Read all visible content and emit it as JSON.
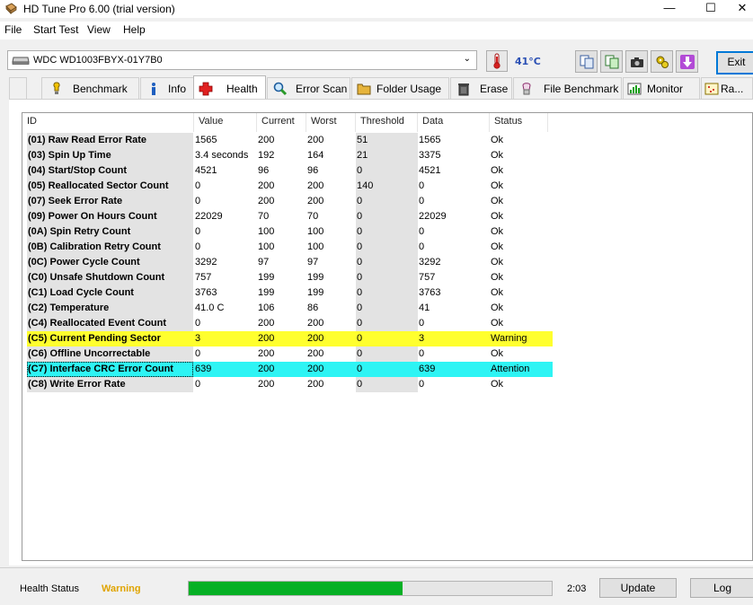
{
  "window": {
    "title": "HD Tune Pro 6.00 (trial version)",
    "minimize": "—",
    "maximize": "☐",
    "close": "✕"
  },
  "menu": {
    "file": "File",
    "start_test": "Start Test",
    "view": "View",
    "help": "Help"
  },
  "drive": {
    "selected": "WDC WD1003FBYX-01Y7B0"
  },
  "temperature": "41°C",
  "toolbar": {
    "exit_label": "Exit"
  },
  "tabs": [
    {
      "label": "Benchmark",
      "icon": "benchmark-icon"
    },
    {
      "label": "Info",
      "icon": "info-icon"
    },
    {
      "label": "Health",
      "icon": "health-cross-icon",
      "active": true
    },
    {
      "label": "Error Scan",
      "icon": "magnifier-icon"
    },
    {
      "label": "Folder Usage",
      "icon": "folder-icon"
    },
    {
      "label": "Erase",
      "icon": "trash-icon"
    },
    {
      "label": "File Benchmark",
      "icon": "file-benchmark-icon"
    },
    {
      "label": "Monitor",
      "icon": "monitor-icon"
    },
    {
      "label": "Ra...",
      "icon": "random-access-icon"
    }
  ],
  "table": {
    "columns": [
      "ID",
      "Value",
      "Current",
      "Worst",
      "Threshold",
      "Data",
      "Status"
    ],
    "rows": [
      {
        "id": "(01) Raw Read Error Rate",
        "value": "1565",
        "current": "200",
        "worst": "200",
        "threshold": "51",
        "data": "1565",
        "status": "Ok"
      },
      {
        "id": "(03) Spin Up Time",
        "value": "3.4 seconds",
        "current": "192",
        "worst": "164",
        "threshold": "21",
        "data": "3375",
        "status": "Ok"
      },
      {
        "id": "(04) Start/Stop Count",
        "value": "4521",
        "current": "96",
        "worst": "96",
        "threshold": "0",
        "data": "4521",
        "status": "Ok"
      },
      {
        "id": "(05) Reallocated Sector Count",
        "value": "0",
        "current": "200",
        "worst": "200",
        "threshold": "140",
        "data": "0",
        "status": "Ok"
      },
      {
        "id": "(07) Seek Error Rate",
        "value": "0",
        "current": "200",
        "worst": "200",
        "threshold": "0",
        "data": "0",
        "status": "Ok"
      },
      {
        "id": "(09) Power On Hours Count",
        "value": "22029",
        "current": "70",
        "worst": "70",
        "threshold": "0",
        "data": "22029",
        "status": "Ok"
      },
      {
        "id": "(0A) Spin Retry Count",
        "value": "0",
        "current": "100",
        "worst": "100",
        "threshold": "0",
        "data": "0",
        "status": "Ok"
      },
      {
        "id": "(0B) Calibration Retry Count",
        "value": "0",
        "current": "100",
        "worst": "100",
        "threshold": "0",
        "data": "0",
        "status": "Ok"
      },
      {
        "id": "(0C) Power Cycle Count",
        "value": "3292",
        "current": "97",
        "worst": "97",
        "threshold": "0",
        "data": "3292",
        "status": "Ok"
      },
      {
        "id": "(C0) Unsafe Shutdown Count",
        "value": "757",
        "current": "199",
        "worst": "199",
        "threshold": "0",
        "data": "757",
        "status": "Ok"
      },
      {
        "id": "(C1) Load Cycle Count",
        "value": "3763",
        "current": "199",
        "worst": "199",
        "threshold": "0",
        "data": "3763",
        "status": "Ok"
      },
      {
        "id": "(C2) Temperature",
        "value": "41.0 C",
        "current": "106",
        "worst": "86",
        "threshold": "0",
        "data": "41",
        "status": "Ok"
      },
      {
        "id": "(C4) Reallocated Event Count",
        "value": "0",
        "current": "200",
        "worst": "200",
        "threshold": "0",
        "data": "0",
        "status": "Ok"
      },
      {
        "id": "(C5) Current Pending Sector",
        "value": "3",
        "current": "200",
        "worst": "200",
        "threshold": "0",
        "data": "3",
        "status": "Warning",
        "highlight": "#ffff2e"
      },
      {
        "id": "(C6) Offline Uncorrectable",
        "value": "0",
        "current": "200",
        "worst": "200",
        "threshold": "0",
        "data": "0",
        "status": "Ok"
      },
      {
        "id": "(C7) Interface CRC Error Count",
        "value": "639",
        "current": "200",
        "worst": "200",
        "threshold": "0",
        "data": "639",
        "status": "Attention",
        "highlight": "#2ef4f4"
      },
      {
        "id": "(C8) Write Error Rate",
        "value": "0",
        "current": "200",
        "worst": "200",
        "threshold": "0",
        "data": "0",
        "status": "Ok"
      }
    ]
  },
  "status_bar": {
    "health_label": "Health Status",
    "health_value": "Warning",
    "health_color": "#e0a400",
    "progress_fraction": 0.59,
    "progress_color": "#06b025",
    "time": "2:03",
    "update_label": "Update",
    "log_label": "Log"
  }
}
